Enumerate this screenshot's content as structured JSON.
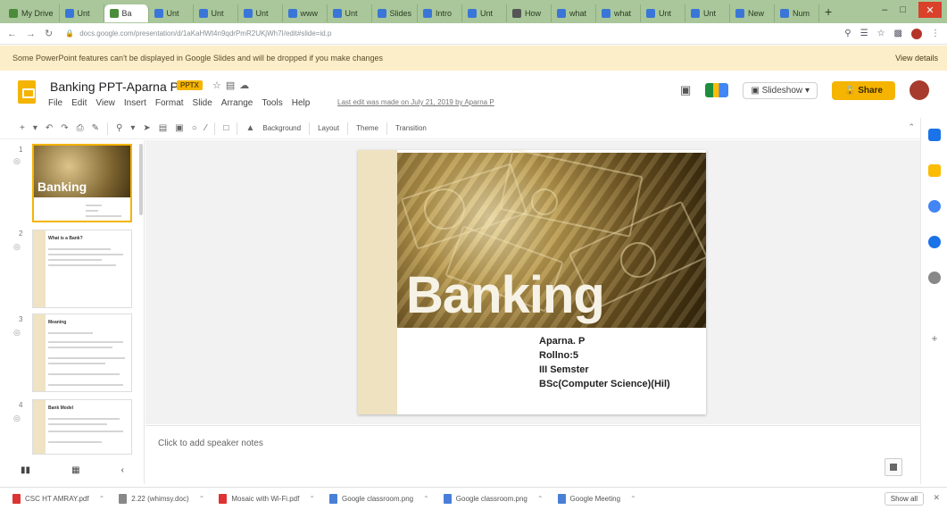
{
  "browser": {
    "tabs": [
      {
        "label": "My Drive",
        "icon": "drive"
      },
      {
        "label": "Unt",
        "icon": "doc"
      },
      {
        "label": "Ba",
        "icon": "slides",
        "active": true
      },
      {
        "label": "Unt",
        "icon": "doc"
      },
      {
        "label": "Unt",
        "icon": "doc"
      },
      {
        "label": "Unt",
        "icon": "doc"
      },
      {
        "label": "www",
        "icon": "doc"
      },
      {
        "label": "Unt",
        "icon": "doc"
      },
      {
        "label": "Slides",
        "icon": "doc"
      },
      {
        "label": "Intro",
        "icon": "doc"
      },
      {
        "label": "Unt",
        "icon": "doc"
      },
      {
        "label": "How",
        "icon": "x"
      },
      {
        "label": "what",
        "icon": "doc"
      },
      {
        "label": "what",
        "icon": "doc"
      },
      {
        "label": "Unt",
        "icon": "doc"
      },
      {
        "label": "Unt",
        "icon": "doc"
      },
      {
        "label": "New",
        "icon": "doc"
      },
      {
        "label": "Num",
        "icon": "doc"
      }
    ],
    "new_tab": "+",
    "url": "docs.google.com/presentation/d/1aKaHWt4n9qdrPmR2UKjWh7I/edit#slide=id.p"
  },
  "banner": {
    "message": "Some PowerPoint features can't be displayed in Google Slides and will be dropped if you make changes",
    "details_link": "View details"
  },
  "header": {
    "title": "Banking PPT-Aparna P",
    "badge": "PPTX",
    "menu": [
      "File",
      "Edit",
      "View",
      "Insert",
      "Format",
      "Slide",
      "Arrange",
      "Tools",
      "Help"
    ],
    "last_edit": "Last edit was made on July 21, 2019 by Aparna P",
    "slideshow_label": "Slideshow",
    "share_label": "Share"
  },
  "toolbar": {
    "background": "Background",
    "layout": "Layout",
    "theme": "Theme",
    "transition": "Transition"
  },
  "filmstrip": {
    "slides": [
      {
        "num": "1",
        "title": "Banking",
        "type": "title"
      },
      {
        "num": "2",
        "title": "What is a Bank?",
        "type": "text"
      },
      {
        "num": "3",
        "title": "Meaning",
        "type": "text"
      },
      {
        "num": "4",
        "title": "Bank Model",
        "type": "text"
      }
    ]
  },
  "slide": {
    "title": "Banking",
    "details": [
      "Aparna. P",
      "Rollno:5",
      "III Semster",
      "BSc(Computer Science)(Hil)"
    ]
  },
  "notes": {
    "placeholder": "Click to add speaker notes"
  },
  "downloads": {
    "items": [
      {
        "name": "CSC HT AMRAY.pdf",
        "icon": "pdf"
      },
      {
        "name": "2.22 (whimsy.doc)",
        "icon": "gray"
      },
      {
        "name": "Mosaic with Wi-Fi.pdf",
        "icon": "pdf"
      },
      {
        "name": "Google classroom.png",
        "icon": "img"
      },
      {
        "name": "Google classroom.png",
        "icon": "img"
      },
      {
        "name": "Google Meeting",
        "icon": "img"
      }
    ],
    "show_all": "Show all"
  },
  "colors": {
    "accent": "#f4b400",
    "tabstrip": "#a9c79a",
    "banner": "#fbeec9"
  }
}
